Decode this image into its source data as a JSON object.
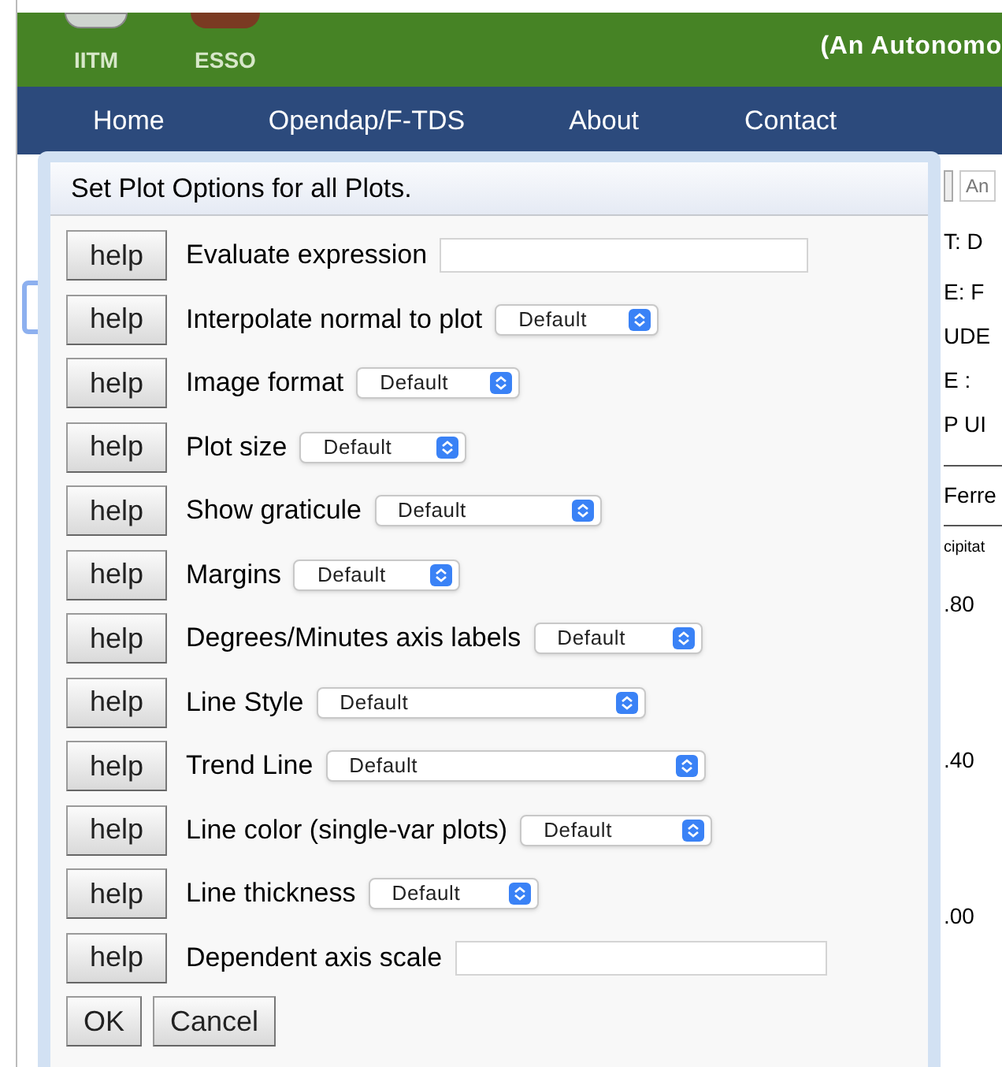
{
  "header": {
    "logos": [
      {
        "label": "IITM"
      },
      {
        "label": "ESSO"
      }
    ],
    "tagline": "(An Autonomo"
  },
  "nav": [
    {
      "label": "Home"
    },
    {
      "label": "Opendap/F-TDS"
    },
    {
      "label": "About"
    },
    {
      "label": "Contact"
    }
  ],
  "background": {
    "field_text": "An",
    "info_lines": [
      "T: D",
      "E: F",
      "UDE",
      "E :",
      "P UI"
    ],
    "tab": "Ferre",
    "column_header": "cipitat",
    "axis_labels": [
      ".80",
      ".40",
      ".00"
    ]
  },
  "dialog": {
    "title": "Set Plot Options for all Plots.",
    "options": [
      {
        "kind": "text",
        "help": "help",
        "label": "Evaluate expression"
      },
      {
        "kind": "select",
        "help": "help",
        "label": "Interpolate normal to plot",
        "value": "Default"
      },
      {
        "kind": "select",
        "help": "help",
        "label": "Image format",
        "value": "Default"
      },
      {
        "kind": "select",
        "help": "help",
        "label": "Plot size",
        "value": "Default"
      },
      {
        "kind": "select",
        "help": "help",
        "label": "Show graticule",
        "value": "Default"
      },
      {
        "kind": "select",
        "help": "help",
        "label": "Margins",
        "value": "Default"
      },
      {
        "kind": "select",
        "help": "help",
        "label": "Degrees/Minutes axis labels",
        "value": "Default"
      },
      {
        "kind": "select",
        "help": "help",
        "label": "Line Style",
        "value": "Default"
      },
      {
        "kind": "select",
        "help": "help",
        "label": "Trend Line",
        "value": "Default"
      },
      {
        "kind": "select",
        "help": "help",
        "label": "Line color (single-var plots)",
        "value": "Default"
      },
      {
        "kind": "select",
        "help": "help",
        "label": "Line thickness",
        "value": "Default"
      },
      {
        "kind": "text",
        "help": "help",
        "label": "Dependent axis scale"
      }
    ],
    "buttons": [
      "OK",
      "Cancel"
    ]
  }
}
